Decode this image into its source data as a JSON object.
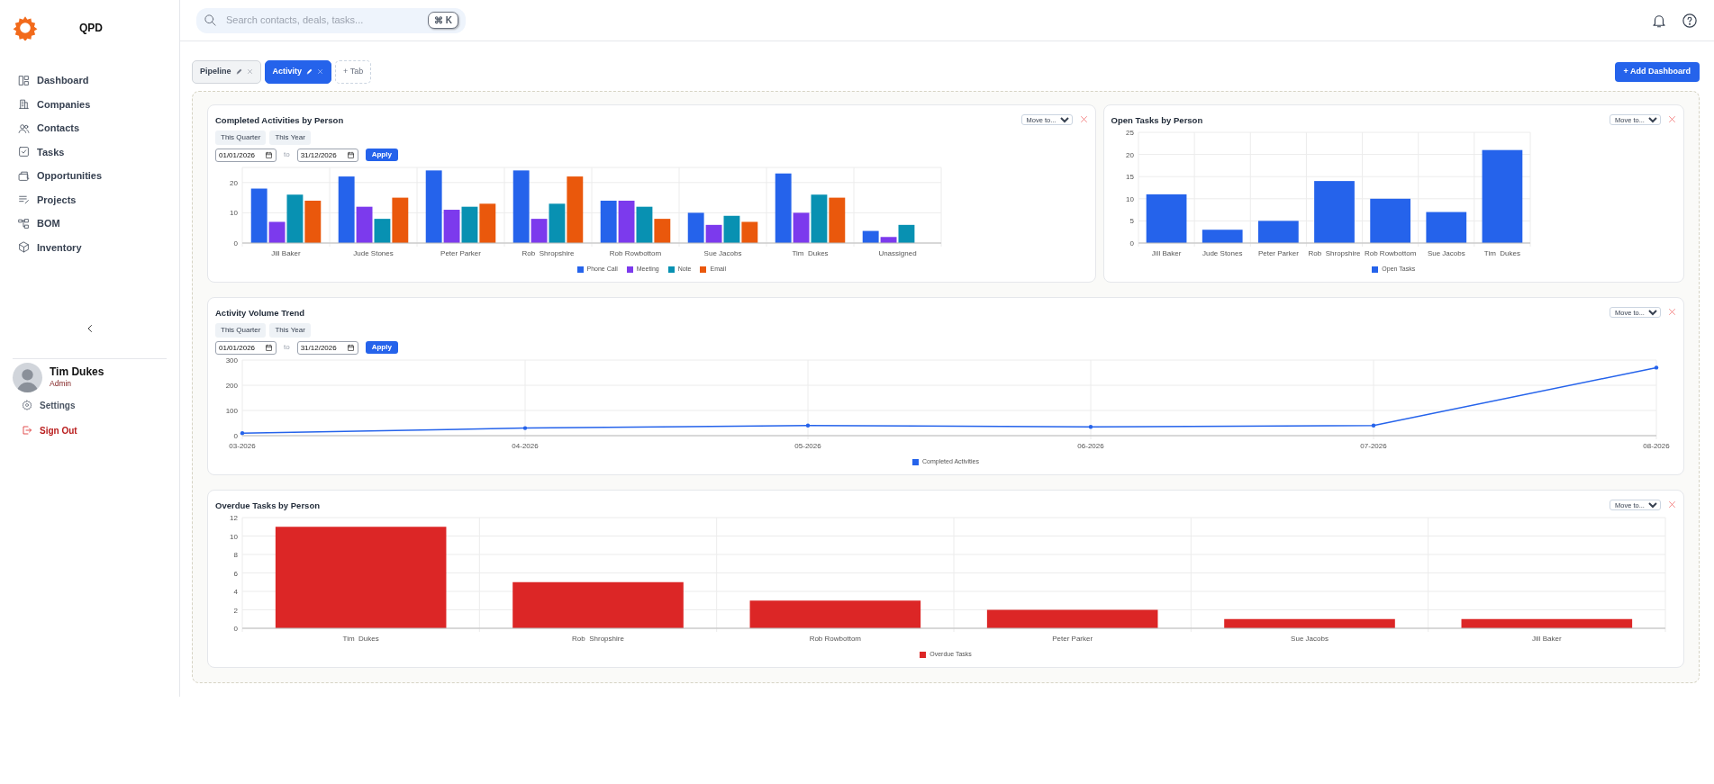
{
  "app": {
    "name": "QPD"
  },
  "sidebar": {
    "items": [
      {
        "label": "Dashboard"
      },
      {
        "label": "Companies"
      },
      {
        "label": "Contacts"
      },
      {
        "label": "Tasks"
      },
      {
        "label": "Opportunities"
      },
      {
        "label": "Projects"
      },
      {
        "label": "BOM"
      },
      {
        "label": "Inventory"
      }
    ]
  },
  "user": {
    "name": "Tim Dukes",
    "role": "Admin"
  },
  "sidebar_footer": [
    {
      "label": "Settings",
      "kind": "settings"
    },
    {
      "label": "Sign Out",
      "kind": "signout"
    }
  ],
  "search": {
    "placeholder": "Search contacts, deals, tasks...",
    "shortcut": "⌘ K"
  },
  "tabs": [
    {
      "label": "Pipeline",
      "selected": false
    },
    {
      "label": "Activity",
      "selected": true
    }
  ],
  "add_tab": "+ Tab",
  "add_dashboard": "+ Add Dashboard",
  "rows": [
    [
      {
        "title": "Completed Activities by Person",
        "move_label": "Move to...",
        "filters": {
          "presets": [
            "This Quarter",
            "This Year"
          ],
          "from": "01/01/2026",
          "separator": "to",
          "to": "31/12/2026",
          "apply": "Apply"
        },
        "chart_data": {
          "type": "bar",
          "grid": true,
          "categories": [
            "Jill Baker",
            "Jude Stones",
            "Peter Parker",
            "Rob  Shropshire",
            "Rob Rowbottom",
            "Sue Jacobs",
            "Tim  Dukes",
            "Unassigned"
          ],
          "ylim": [
            0,
            25
          ],
          "yticks": [
            0,
            10,
            20
          ],
          "series": [
            {
              "name": "Phone Call",
              "color": "#2563eb",
              "values": [
                18,
                22,
                24,
                24,
                14,
                10,
                23,
                4
              ]
            },
            {
              "name": "Meeting",
              "color": "#7c3aed",
              "values": [
                7,
                12,
                11,
                8,
                14,
                6,
                10,
                2
              ]
            },
            {
              "name": "Note",
              "color": "#0891b2",
              "values": [
                16,
                8,
                12,
                13,
                12,
                9,
                16,
                6
              ]
            },
            {
              "name": "Email",
              "color": "#ea580c",
              "values": [
                14,
                15,
                13,
                22,
                8,
                7,
                15,
                null
              ]
            }
          ]
        }
      },
      {
        "title": "Open Tasks by Person",
        "move_label": "Move to...",
        "chart_data": {
          "type": "bar",
          "grid": true,
          "categories": [
            "Jill Baker",
            "Jude Stones",
            "Peter Parker",
            "Rob  Shropshire",
            "Rob Rowbottom",
            "Sue Jacobs",
            "Tim  Dukes"
          ],
          "ylim": [
            0,
            25
          ],
          "yticks": [
            0,
            5,
            10,
            15,
            20,
            25
          ],
          "series": [
            {
              "name": "Open Tasks",
              "color": "#2563eb",
              "values": [
                11,
                3,
                5,
                14,
                10,
                7,
                21
              ]
            }
          ]
        }
      }
    ],
    [
      {
        "title": "Activity Volume Trend",
        "move_label": "Move to...",
        "filters": {
          "presets": [
            "This Quarter",
            "This Year"
          ],
          "from": "01/01/2026",
          "separator": "to",
          "to": "31/12/2026",
          "apply": "Apply"
        },
        "chart_data": {
          "type": "line",
          "grid": true,
          "categories": [
            "03-2026",
            "04-2026",
            "05-2026",
            "06-2026",
            "07-2026",
            "08-2026"
          ],
          "ylim": [
            0,
            300
          ],
          "yticks": [
            0,
            100,
            200,
            300
          ],
          "series": [
            {
              "name": "Completed Activities",
              "color": "#2563eb",
              "values": [
                10,
                30,
                40,
                35,
                40,
                270
              ]
            }
          ]
        }
      }
    ],
    [
      {
        "title": "Overdue Tasks by Person",
        "move_label": "Move to...",
        "chart_data": {
          "type": "bar",
          "grid": true,
          "categories": [
            "Tim  Dukes",
            "Rob  Shropshire",
            "Rob Rowbottom",
            "Peter Parker",
            "Sue Jacobs",
            "Jill Baker"
          ],
          "ylim": [
            0,
            12
          ],
          "yticks": [
            0,
            2,
            4,
            6,
            8,
            10,
            12
          ],
          "series": [
            {
              "name": "Overdue Tasks",
              "color": "#dc2626",
              "values": [
                11,
                5,
                3,
                2,
                1,
                1
              ]
            }
          ]
        }
      }
    ]
  ]
}
